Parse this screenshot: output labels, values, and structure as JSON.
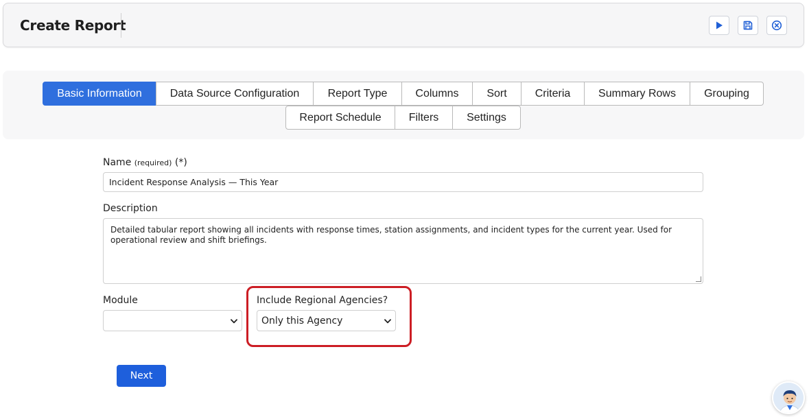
{
  "header": {
    "title": "Create Report",
    "buttons": [
      {
        "name": "run-button",
        "icon": "play-icon"
      },
      {
        "name": "save-button",
        "icon": "floppy-disk-icon"
      },
      {
        "name": "close-button",
        "icon": "close-circle-icon"
      }
    ]
  },
  "tabs": [
    {
      "label": "Basic Information",
      "active": true
    },
    {
      "label": "Data Source Configuration"
    },
    {
      "label": "Report Type"
    },
    {
      "label": "Columns"
    },
    {
      "label": "Sort"
    },
    {
      "label": "Criteria"
    },
    {
      "label": "Summary Rows"
    },
    {
      "label": "Grouping"
    },
    {
      "label": "Report Schedule"
    },
    {
      "label": "Filters"
    },
    {
      "label": "Settings"
    }
  ],
  "form": {
    "name": {
      "label": "Name",
      "required_note": "(required)",
      "asterisk": "(*)",
      "value": "Incident Response Analysis — This Year"
    },
    "description": {
      "label": "Description",
      "value": "Detailed tabular report showing all incidents with response times, station assignments, and incident types for the current year. Used for operational review and shift briefings."
    },
    "module": {
      "label": "Module",
      "value": ""
    },
    "regional": {
      "label": "Include Regional Agencies?",
      "value": "Only this Agency"
    }
  },
  "actions": {
    "next_label": "Next"
  },
  "colors": {
    "accent": "#2f6fde",
    "highlight": "#cc1d24",
    "next_button": "#1e5fdc"
  }
}
